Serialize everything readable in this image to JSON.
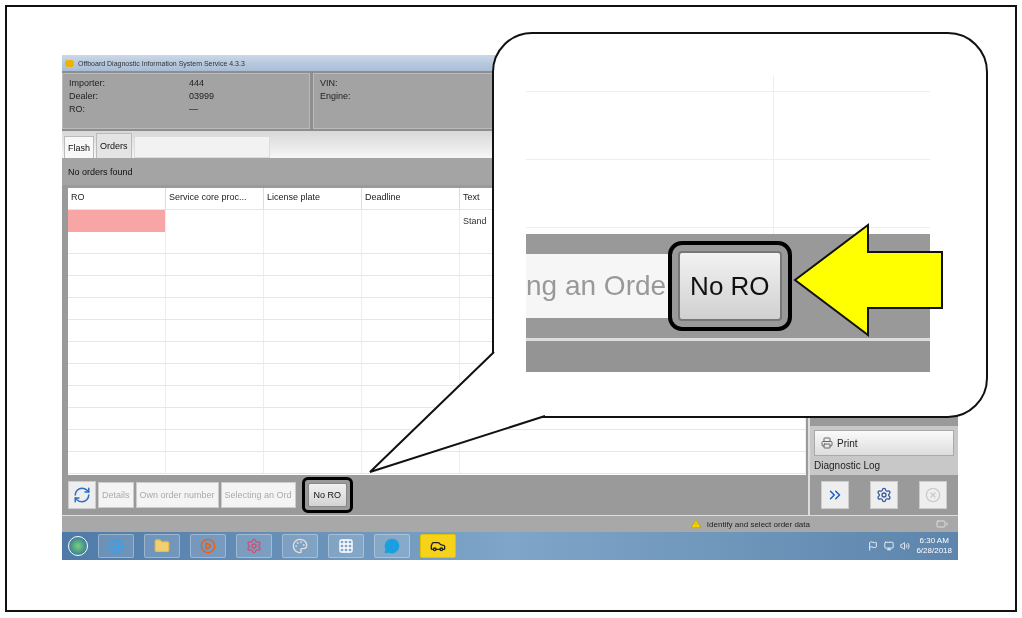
{
  "window": {
    "title": "Offboard Diagnostic Information System Service  4.3.3"
  },
  "header": {
    "left": [
      {
        "label": "Importer:",
        "value": "444"
      },
      {
        "label": "Dealer:",
        "value": "03999"
      },
      {
        "label": "RO:",
        "value": "—"
      }
    ],
    "right": [
      {
        "label": "VIN:"
      },
      {
        "label": "Engine:"
      }
    ]
  },
  "tabs": [
    {
      "label": "Flash",
      "selected": false
    },
    {
      "label": "Orders",
      "selected": true
    }
  ],
  "message": "No orders found",
  "table": {
    "columns": [
      "RO",
      "Service core proc...",
      "License plate",
      "Deadline",
      "Text"
    ],
    "rows": [
      {
        "cells": [
          "",
          "",
          "",
          "",
          "Stand"
        ],
        "invalid": true
      }
    ]
  },
  "toolbar": {
    "buttons": [
      {
        "label": "Details",
        "highlighted": false
      },
      {
        "label": "Own order number",
        "highlighted": false
      },
      {
        "label": "Selecting an Ord",
        "highlighted": false
      },
      {
        "label": "No RO",
        "highlighted": true
      }
    ]
  },
  "side_panel": {
    "print_button": "Print",
    "section": "Diagnostic Log"
  },
  "status_bar": {
    "message": "Identify and select order data"
  },
  "taskbar": {
    "time": "6:30 AM",
    "date": "6/28/2018"
  },
  "callout": {
    "partial_text": "ng an Orde",
    "button": "No RO"
  }
}
